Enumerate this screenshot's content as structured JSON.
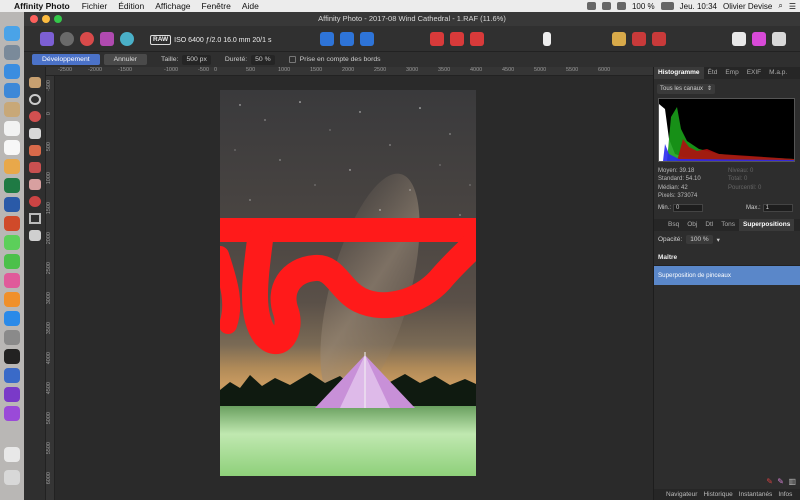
{
  "menubar": {
    "app": "Affinity Photo",
    "items": [
      "Fichier",
      "Édition",
      "Affichage",
      "Fenêtre",
      "Aide"
    ],
    "battery": "100 %",
    "clock": "Jeu. 10:34",
    "user": "Olivier Devise"
  },
  "window": {
    "title": "Affinity Photo - 2017-08 Wind Cathedral - 1.RAF (11.6%)"
  },
  "toolbar": {
    "raw_badge": "RAW",
    "exif": "ISO 6400 ƒ/2.0 16.0 mm 20/1 s"
  },
  "context": {
    "develop_label": "Développement",
    "cancel_label": "Annuler",
    "size_label": "Taille:",
    "size_value": "500 px",
    "hardness_label": "Dureté:",
    "hardness_value": "50 %",
    "edge_label": "Prise en compte des bords"
  },
  "ruler": {
    "h": [
      "-2500",
      "-2000",
      "-1500",
      "-1000",
      "-500",
      "0",
      "500",
      "1000",
      "1500",
      "2000",
      "2500",
      "3000",
      "3500",
      "4000",
      "4500",
      "5000",
      "5500",
      "6000"
    ],
    "v": [
      "-500",
      "0",
      "500",
      "1000",
      "1500",
      "2000",
      "2500",
      "3000",
      "3500",
      "4000",
      "4500",
      "5000",
      "5500",
      "6000"
    ]
  },
  "panel": {
    "top_tabs": [
      "Histogramme",
      "Étd",
      "Emp",
      "EXIF",
      "M.a.p."
    ],
    "channel": "Tous les canaux",
    "stats": [
      "Moyen: 39.18",
      "Standard: 54.10",
      "Médian: 42",
      "Pixels: 373074"
    ],
    "stats_dim": [
      "Niveau: 0",
      "Total: 0",
      "Pourcentil: 0"
    ],
    "min_label": "Min.:",
    "min_value": "0",
    "max_label": "Max.:",
    "max_value": "1",
    "mid_tabs": [
      "Bsq",
      "Obj",
      "Dtl",
      "Tons",
      "Superpositions"
    ],
    "opacity_label": "Opacité:",
    "opacity_value": "100 %",
    "layer_master": "Maître",
    "layer_selected": "Superposition de pinceaux",
    "bottom_tabs": [
      "Navigateur",
      "Historique",
      "Instantanés",
      "Infos"
    ]
  }
}
